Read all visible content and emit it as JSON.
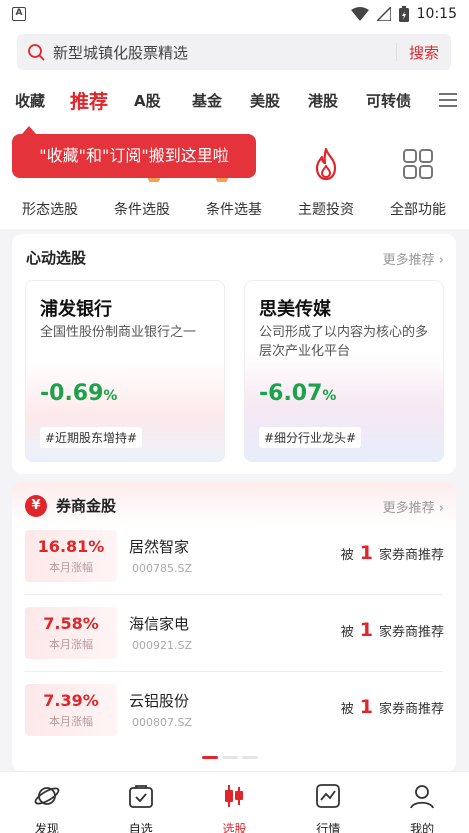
{
  "status_bar": {
    "time": "10:15",
    "app_badge": "A"
  },
  "search": {
    "placeholder": "新型城镇化股票精选",
    "button": "搜索"
  },
  "tabs": [
    "收藏",
    "推荐",
    "A股",
    "基金",
    "美股",
    "港股",
    "可转债"
  ],
  "active_tab": "推荐",
  "tools": [
    {
      "label": "形态选股",
      "icon": "pattern-icon"
    },
    {
      "label": "条件选股",
      "icon": "filter-icon"
    },
    {
      "label": "条件选基",
      "icon": "fund-filter-icon"
    },
    {
      "label": "主题投资",
      "icon": "flame-icon"
    },
    {
      "label": "全部功能",
      "icon": "grid-icon"
    }
  ],
  "tooltip": "\"收藏\"和\"订阅\"搬到这里啦",
  "picks": {
    "title": "心动选股",
    "more": "更多推荐",
    "items": [
      {
        "name": "浦发银行",
        "desc": "全国性股份制商业银行之一",
        "change": "-0.69",
        "unit": "%",
        "tag": "#近期股东增持#"
      },
      {
        "name": "思美传媒",
        "desc": "公司形成了以内容为核心的多层次产业化平台",
        "change": "-6.07",
        "unit": "%",
        "tag": "#细分行业龙头#"
      }
    ]
  },
  "broker": {
    "title": "券商金股",
    "icon_text": "¥",
    "more": "更多推荐",
    "pct_label": "本月涨幅",
    "rec_prefix": "被",
    "rec_suffix": "家券商推荐",
    "rows": [
      {
        "pct": "16.81%",
        "name": "居然智家",
        "code": "000785.SZ",
        "count": "1"
      },
      {
        "pct": "7.58%",
        "name": "海信家电",
        "code": "000921.SZ",
        "count": "1"
      },
      {
        "pct": "7.39%",
        "name": "云铝股份",
        "code": "000807.SZ",
        "count": "1"
      }
    ]
  },
  "nav": [
    {
      "label": "发现",
      "icon": "planet-icon"
    },
    {
      "label": "自选",
      "icon": "bag-check-icon"
    },
    {
      "label": "选股",
      "icon": "candlestick-icon"
    },
    {
      "label": "行情",
      "icon": "chart-line-icon"
    },
    {
      "label": "我的",
      "icon": "user-icon"
    }
  ],
  "colors": {
    "accent": "#e0262b",
    "down": "#1aa34a"
  }
}
